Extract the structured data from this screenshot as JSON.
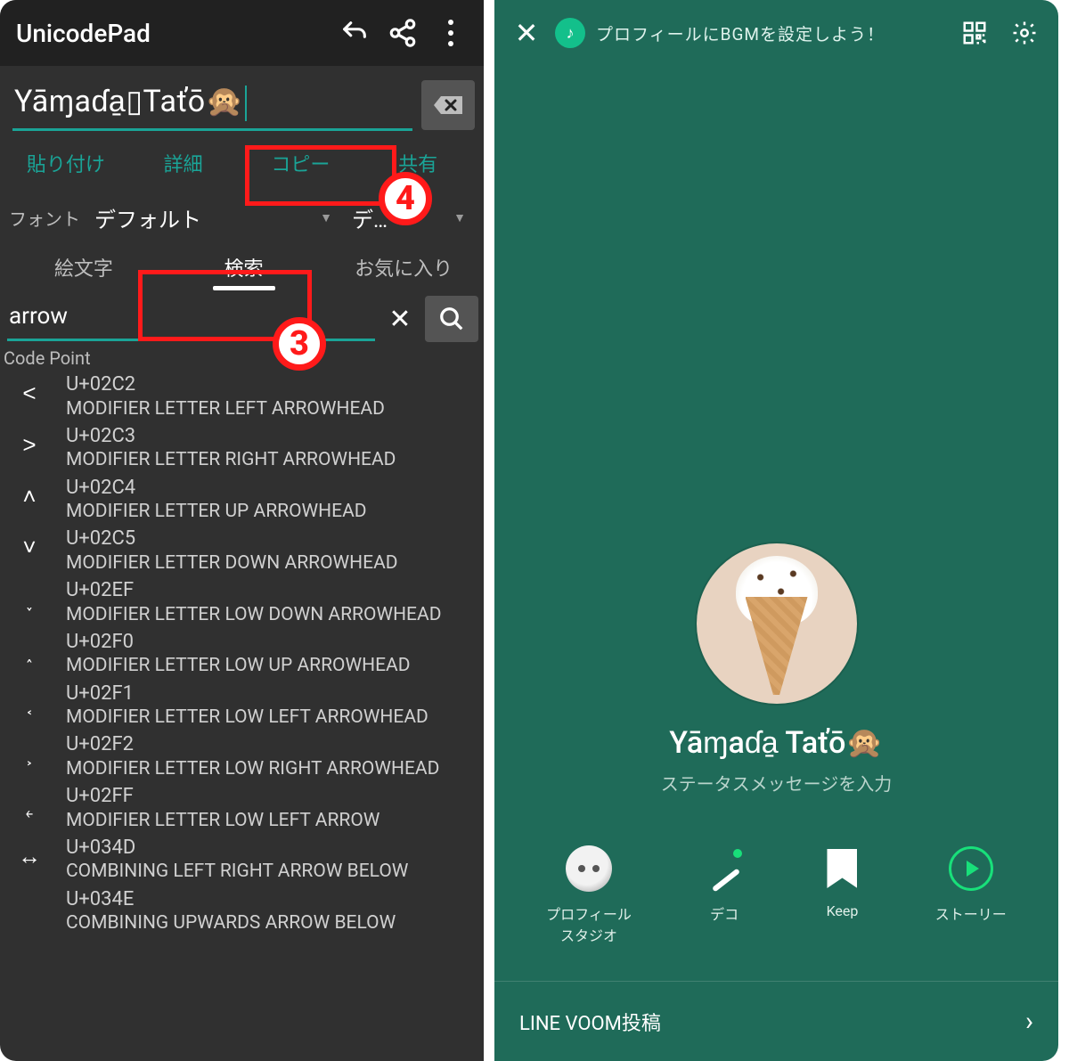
{
  "left": {
    "title": "UnicodePad",
    "edit_value": "Yāɱaɗa̱▯Taťō🙊",
    "actions": {
      "paste": "貼り付け",
      "detail": "詳細",
      "copy": "コピー",
      "share": "共有"
    },
    "font_label": "フォント",
    "font_value": "デフォルト",
    "font2_value": "デ…",
    "tabs": {
      "emoji": "絵文字",
      "search": "検索",
      "favorite": "お気に入り"
    },
    "search_value": "arrow",
    "list_header": "Code Point",
    "results": [
      {
        "glyph": "˂",
        "code": "U+02C2",
        "name": "MODIFIER LETTER LEFT ARROWHEAD"
      },
      {
        "glyph": "˃",
        "code": "U+02C3",
        "name": "MODIFIER LETTER RIGHT ARROWHEAD"
      },
      {
        "glyph": "˄",
        "code": "U+02C4",
        "name": "MODIFIER LETTER UP ARROWHEAD"
      },
      {
        "glyph": "˅",
        "code": "U+02C5",
        "name": "MODIFIER LETTER DOWN ARROWHEAD"
      },
      {
        "glyph": "˯",
        "code": "U+02EF",
        "name": "MODIFIER LETTER LOW DOWN ARROWHEAD"
      },
      {
        "glyph": "˰",
        "code": "U+02F0",
        "name": "MODIFIER LETTER LOW UP ARROWHEAD"
      },
      {
        "glyph": "˱",
        "code": "U+02F1",
        "name": "MODIFIER LETTER LOW LEFT ARROWHEAD"
      },
      {
        "glyph": "˲",
        "code": "U+02F2",
        "name": "MODIFIER LETTER LOW RIGHT ARROWHEAD"
      },
      {
        "glyph": "˿",
        "code": "U+02FF",
        "name": "MODIFIER LETTER LOW LEFT ARROW"
      },
      {
        "glyph": "↔",
        "code": "U+034D",
        "name": "COMBINING LEFT RIGHT ARROW BELOW"
      },
      {
        "glyph": "",
        "code": "U+034E",
        "name": "COMBINING UPWARDS ARROW BELOW"
      }
    ],
    "callouts": {
      "three": "3",
      "four": "4"
    }
  },
  "right": {
    "bgm_text": "プロフィールにBGMを設定しよう！",
    "display_name": "Yāɱaɗa̱ Taťō🙊",
    "status_placeholder": "ステータスメッセージを入力",
    "actions": {
      "studio": "プロフィール\nスタジオ",
      "deco": "デコ",
      "keep": "Keep",
      "story": "ストーリー"
    },
    "voom": "LINE VOOM投稿"
  }
}
